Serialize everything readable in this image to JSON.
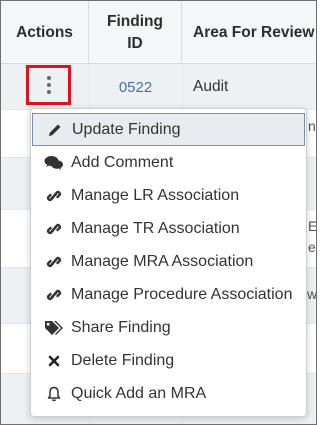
{
  "table": {
    "headers": {
      "actions": "Actions",
      "finding_id_line1": "Finding",
      "finding_id_line2": "ID",
      "area": "Area For Review"
    },
    "first_row": {
      "finding_id": "0522",
      "area": "Audit"
    },
    "partial_text": {
      "row2_right": "n",
      "row4_right_a": "E",
      "row4_right_b": "e",
      "row5_right": "w"
    }
  },
  "menu": {
    "items": [
      {
        "label": "Update Finding",
        "icon": "pencil-icon"
      },
      {
        "label": "Add Comment",
        "icon": "comments-icon"
      },
      {
        "label": "Manage LR Association",
        "icon": "link-icon"
      },
      {
        "label": "Manage TR Association",
        "icon": "link-icon"
      },
      {
        "label": "Manage MRA Association",
        "icon": "link-icon"
      },
      {
        "label": "Manage Procedure Association",
        "icon": "link-icon"
      },
      {
        "label": "Share Finding",
        "icon": "tags-icon"
      },
      {
        "label": "Delete Finding",
        "icon": "x-icon"
      },
      {
        "label": "Quick Add an MRA",
        "icon": "bell-icon"
      }
    ]
  },
  "colors": {
    "highlight_border": "#e0111a",
    "link_text": "#4a6fa0",
    "header_bg": "#f4f6f8",
    "row_alt_bg": "#eef1f4"
  }
}
